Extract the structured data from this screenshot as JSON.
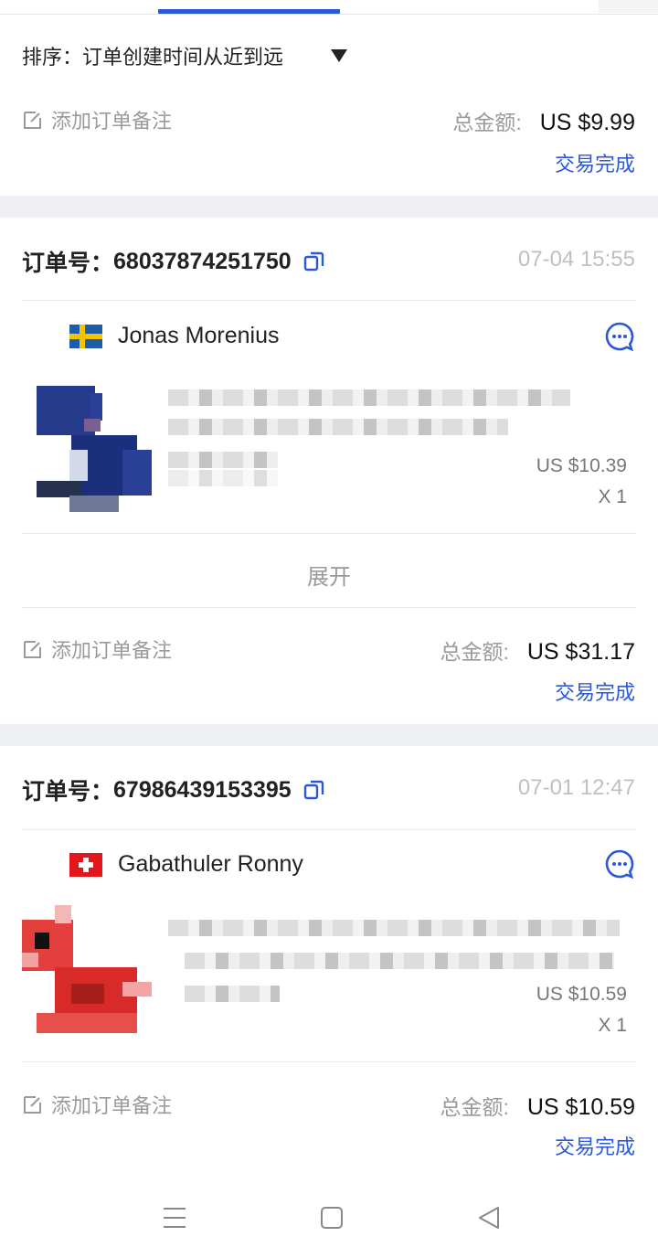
{
  "sort": {
    "label": "排序：订单创建时间从近到远"
  },
  "top_order": {
    "note_label": "添加订单备注",
    "total_label": "总金额:",
    "total_value": "US $9.99",
    "status": "交易完成"
  },
  "orders": [
    {
      "order_label": "订单号：",
      "order_no": "68037874251750",
      "date": "07-04 15:55",
      "buyer": "Jonas Morenius",
      "country": "SE",
      "item_price": "US $10.39",
      "item_qty": "X 1",
      "expand_label": "展开",
      "note_label": "添加订单备注",
      "total_label": "总金额:",
      "total_value": "US $31.17",
      "status": "交易完成"
    },
    {
      "order_label": "订单号：",
      "order_no": "67986439153395",
      "date": "07-01 12:47",
      "buyer": "Gabathuler Ronny",
      "country": "CH",
      "item_price": "US $10.59",
      "item_qty": "X 1",
      "note_label": "添加订单备注",
      "total_label": "总金额:",
      "total_value": "US $10.59",
      "status": "交易完成"
    }
  ],
  "colors": {
    "accent": "#2b57d9",
    "muted": "#9a9a9a",
    "separator": "#eef0f4"
  },
  "icons": [
    "note-edit-icon",
    "copy-icon",
    "chat-icon",
    "menu-icon",
    "home-square-icon",
    "back-triangle-icon"
  ]
}
